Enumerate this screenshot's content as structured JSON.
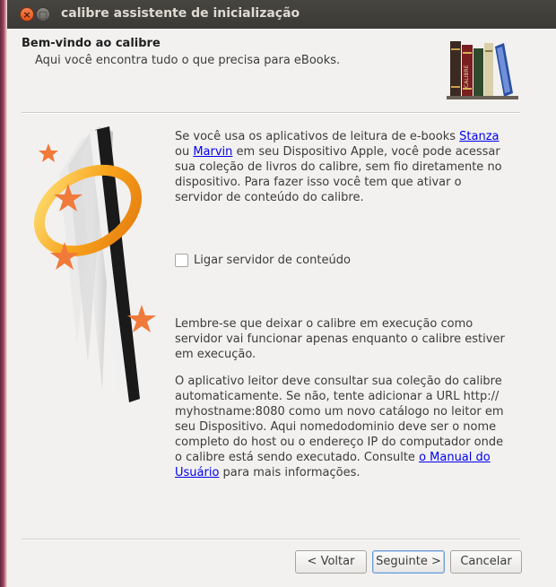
{
  "window": {
    "title": "calibre assistente de inicialização",
    "close_glyph": "×",
    "maximize_glyph": "▢"
  },
  "header": {
    "title": "Bem-vindo ao calibre",
    "subtitle": "Aqui você encontra tudo o que precisa para eBooks."
  },
  "books_icon": {
    "name": "books-icon",
    "spine_text": "CALIBRE"
  },
  "main": {
    "intro": {
      "before_stanza": "Se você usa os aplicativos de leitura de e-books ",
      "stanza_link": "Stanza",
      "before_marvin": " ou ",
      "marvin_link": "Marvin",
      "after_marvin": " em seu Dispositivo Apple, você pode acessar sua coleção de livros do calibre, sem fio diretamente no dispositivo. Para fazer isso você tem que ativar o servidor de conteúdo do calibre."
    },
    "checkbox_label": "Ligar servidor de conteúdo",
    "checkbox_checked": false,
    "reminder": "Lembre-se que deixar o calibre em execução como servidor vai funcionar apenas enquanto o calibre estiver em execução.",
    "instructions": {
      "text": "O aplicativo leitor deve consultar sua coleção do calibre automaticamente. Se não, tente adicionar a URL http:// myhostname:8080 como um novo catálogo no leitor em seu Dispositivo. Aqui nomedodominio deve ser o nome completo do host ou o endereço IP do computador onde o calibre está sendo executado. Consulte ",
      "manual_link": "o Manual do Usuário",
      "after_link": " para mais informações."
    }
  },
  "buttons": {
    "back": "< Voltar",
    "next": "Seguinte >",
    "cancel": "Cancelar"
  }
}
